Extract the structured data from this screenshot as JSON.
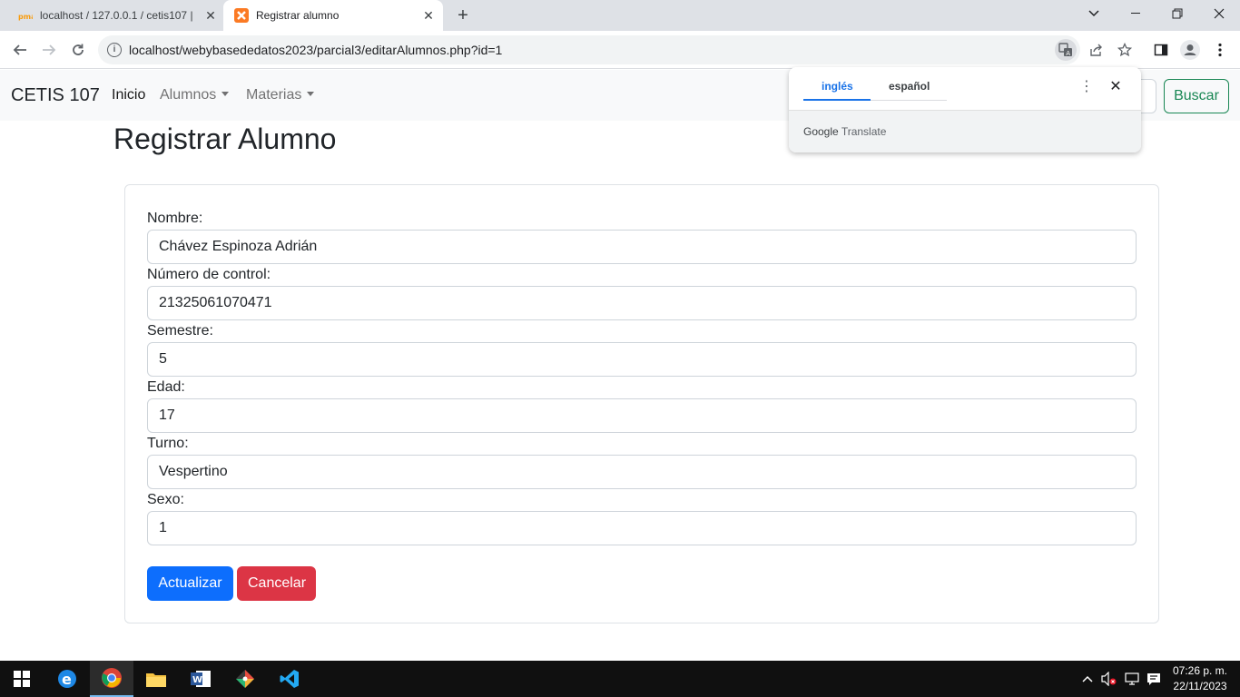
{
  "browser": {
    "tabs": [
      {
        "title": "localhost / 127.0.0.1 / cetis107 |",
        "icon": "phpmyadmin-icon"
      },
      {
        "title": "Registrar alumno",
        "icon": "xampp-icon"
      }
    ],
    "url": "localhost/webybasededatos2023/parcial3/editarAlumnos.php?id=1"
  },
  "navbar": {
    "brand": "CETIS 107",
    "links": {
      "inicio": "Inicio",
      "alumnos": "Alumnos",
      "materias": "Materias"
    },
    "search_button": "Buscar"
  },
  "translate": {
    "tab_source": "inglés",
    "tab_target": "español",
    "brand_google": "Google",
    "brand_translate": "Translate"
  },
  "page": {
    "title": "Registrar Alumno"
  },
  "form": {
    "nombre_label": "Nombre:",
    "nombre_value": "Chávez Espinoza Adrián",
    "control_label": "Número de control:",
    "control_value": "21325061070471",
    "semestre_label": "Semestre:",
    "semestre_value": "5",
    "edad_label": "Edad:",
    "edad_value": "17",
    "turno_label": "Turno:",
    "turno_value": "Vespertino",
    "sexo_label": "Sexo:",
    "sexo_value": "1",
    "submit_label": "Actualizar",
    "cancel_label": "Cancelar"
  },
  "taskbar": {
    "time": "07:26 p. m.",
    "date": "22/11/2023"
  },
  "colors": {
    "primary": "#0d6efd",
    "danger": "#dc3545",
    "success": "#198754",
    "translate_accent": "#1a73e8"
  }
}
